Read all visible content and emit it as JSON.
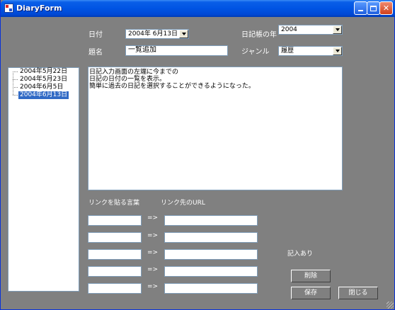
{
  "window": {
    "title": "DiaryForm"
  },
  "form": {
    "date_label": "日付",
    "date_value": "2004年 6月13日",
    "year_label": "日記帳の年",
    "year_value": "2004",
    "title_label": "題名",
    "title_value": "一覧追加",
    "genre_label": "ジャンル",
    "genre_value": "履歴"
  },
  "tree": {
    "items": [
      "2004年5月22日",
      "2004年5月23日",
      "2004年6月5日",
      "2004年6月13日"
    ],
    "selected_index": 3
  },
  "memo": {
    "lines": [
      "日記入力画面の左端に今までの",
      "日記の日付の一覧を表示。",
      "簡単に過去の日記を選択することができるようになった。"
    ]
  },
  "links": {
    "text_label": "リンクを貼る言葉",
    "url_label": "リンク先のURL",
    "arrow": "=>",
    "rows": [
      {
        "text": "",
        "url": ""
      },
      {
        "text": "",
        "url": ""
      },
      {
        "text": "",
        "url": ""
      },
      {
        "text": "",
        "url": ""
      },
      {
        "text": "",
        "url": ""
      }
    ]
  },
  "status": {
    "text": "記入あり"
  },
  "buttons": {
    "delete": "削除",
    "save": "保存",
    "close": "閉じる"
  },
  "colors": {
    "form_bg": "#808080",
    "titlebar": "#0054e3",
    "selection": "#316ac5"
  }
}
